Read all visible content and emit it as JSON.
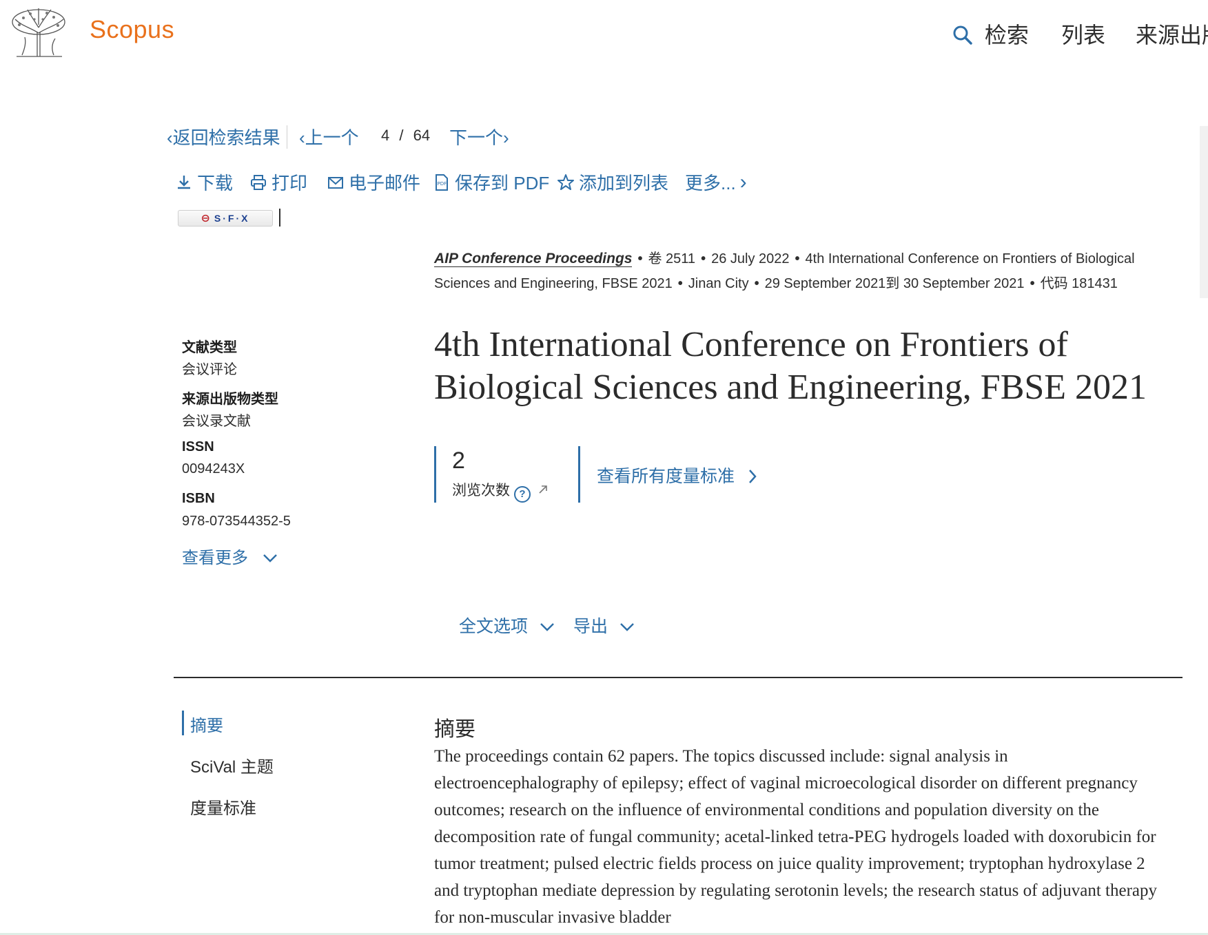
{
  "header": {
    "brand": "Scopus",
    "nav": [
      {
        "label": "检索"
      },
      {
        "label": "列表"
      },
      {
        "label": "来源出版"
      }
    ]
  },
  "navrow": {
    "back": "返回检索结果",
    "prev": "上一个",
    "position": "4",
    "separator": "/",
    "total": "64",
    "next": "下一个"
  },
  "toolbar": {
    "download": "下载",
    "print": "打印",
    "email": "电子邮件",
    "save_pdf": "保存到 PDF",
    "add_list": "添加到列表",
    "more": "更多..."
  },
  "sfx": {
    "label": "S·F·X"
  },
  "source": {
    "journal": "AIP Conference Proceedings",
    "volume": "卷 2511",
    "date": "26 July 2022",
    "conference": "4th International Conference on Frontiers of Biological Sciences and Engineering, FBSE 2021",
    "city": "Jinan City",
    "dates": "29 September 2021到 30 September 2021",
    "code": "代码 181431"
  },
  "details": {
    "doc_type_label": "文献类型",
    "doc_type_value": "会议评论",
    "source_type_label": "来源出版物类型",
    "source_type_value": "会议录文献",
    "issn_label": "ISSN",
    "issn_value": "0094243X",
    "isbn_label": "ISBN",
    "isbn_value": "978-073544352-5",
    "see_more": "查看更多"
  },
  "title": "4th International Conference on Frontiers of Biological Sciences and Engineering, FBSE 2021",
  "metrics": {
    "views": "2",
    "views_label": "浏览次数",
    "view_all": "查看所有度量标准"
  },
  "options": {
    "full_text": "全文选项",
    "export": "导出"
  },
  "toc": {
    "abstract": "摘要",
    "scival": "SciVal 主题",
    "metrics": "度量标准"
  },
  "abstract": {
    "heading": "摘要",
    "text": "The proceedings contain 62 papers. The topics discussed include: signal analysis in electroencephalography of epilepsy; effect of vaginal microecological disorder on different pregnancy outcomes; research on the influence of environmental conditions and population diversity on the decomposition rate of fungal community; acetal-linked tetra-PEG hydrogels loaded with doxorubicin for tumor treatment; pulsed electric fields process on juice quality improvement; tryptophan hydroxylase 2 and tryptophan mediate depression by regulating serotonin levels; the research status of adjuvant therapy for non-muscular invasive bladder"
  },
  "colors": {
    "brand": "#e9711c",
    "link": "#2e6fa8",
    "text": "#2e2e2e"
  }
}
